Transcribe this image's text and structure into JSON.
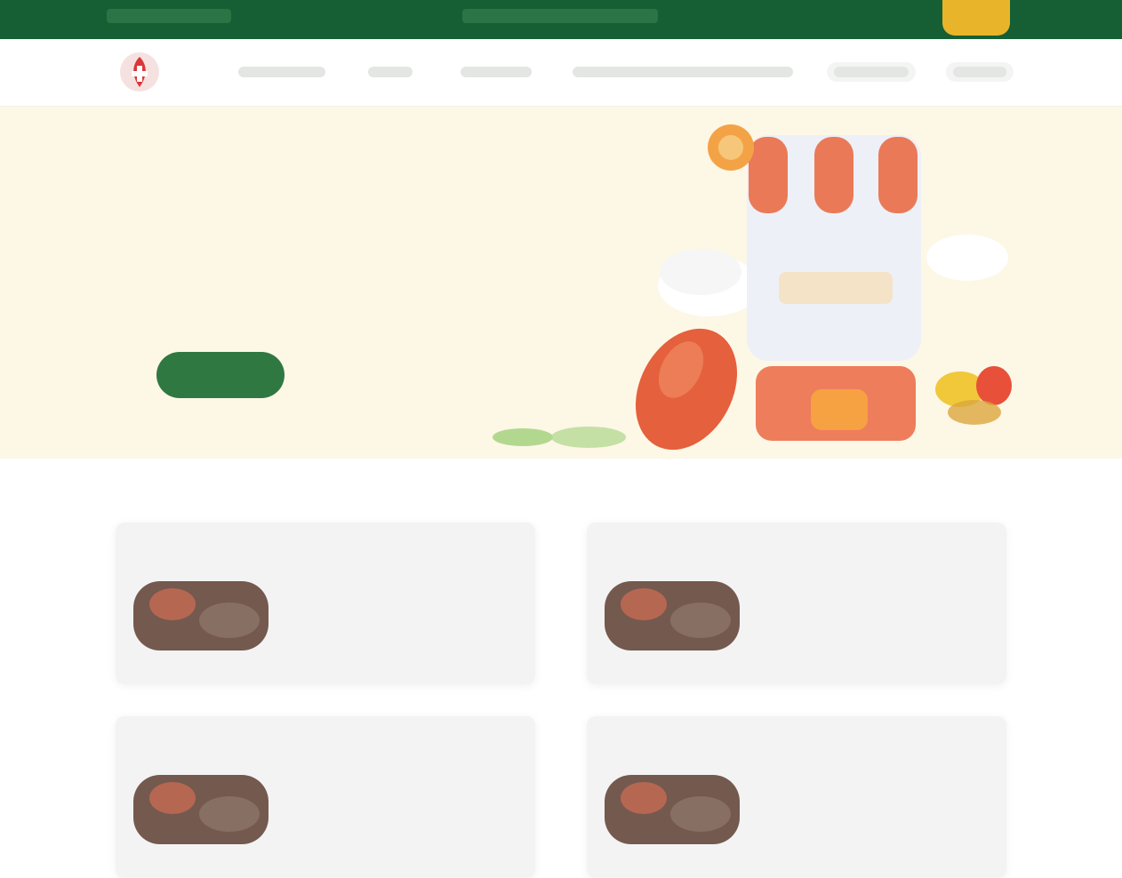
{
  "topbar": {
    "left_text": "",
    "center_text": "",
    "promo_label": ""
  },
  "nav": {
    "items": [
      {
        "label": ""
      },
      {
        "label": ""
      },
      {
        "label": ""
      },
      {
        "label": ""
      },
      {
        "label": ""
      },
      {
        "label": ""
      }
    ]
  },
  "hero": {
    "title_line1": "",
    "title_line2": "",
    "cta_label": ""
  },
  "section": {
    "title": ""
  },
  "cards": [
    {
      "name": "",
      "description": "",
      "price": ""
    },
    {
      "name": "",
      "description": "",
      "price": ""
    },
    {
      "name": "",
      "description": "",
      "price": ""
    },
    {
      "name": "",
      "description": "",
      "price": ""
    }
  ],
  "colors": {
    "brand_green": "#165f35",
    "accent_yellow": "#e8b52a",
    "hero_bg": "#fdf7e6",
    "hero_title": "#5e9a5c",
    "cta_bg": "#2f7842",
    "logo_red": "#d9373a"
  },
  "icons": [
    "brand-logo-icon",
    "vitamin-bottle-icon",
    "capsule-icon",
    "softgel-icon",
    "leaf-icon"
  ]
}
